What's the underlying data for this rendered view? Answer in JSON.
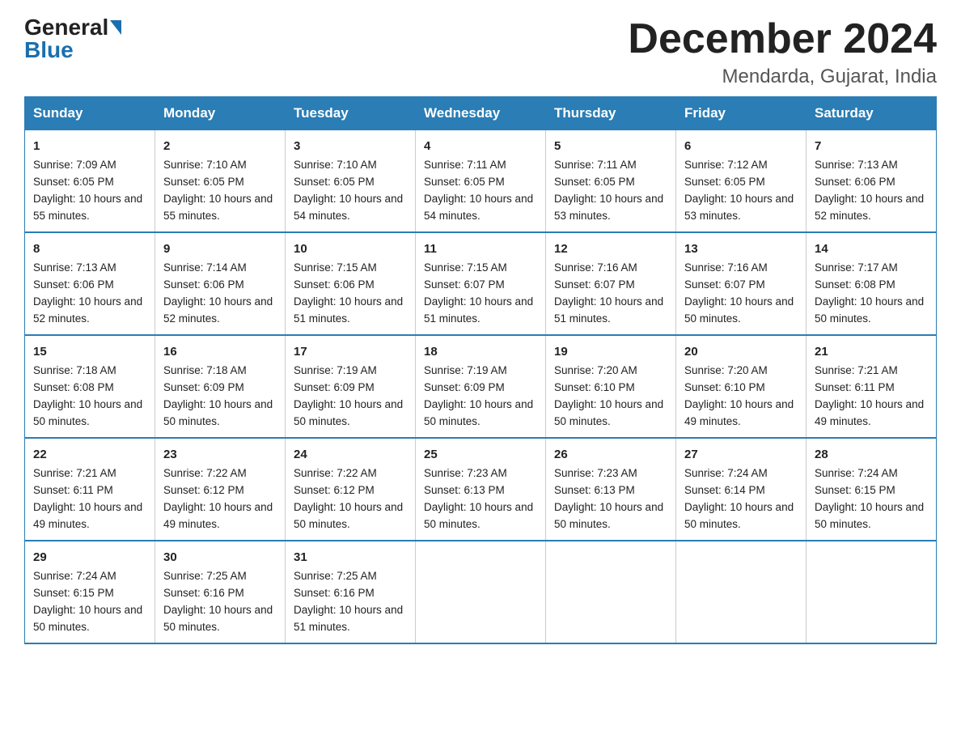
{
  "header": {
    "logo_general": "General",
    "logo_blue": "Blue",
    "month_year": "December 2024",
    "location": "Mendarda, Gujarat, India"
  },
  "days_of_week": [
    "Sunday",
    "Monday",
    "Tuesday",
    "Wednesday",
    "Thursday",
    "Friday",
    "Saturday"
  ],
  "weeks": [
    [
      {
        "day": 1,
        "sunrise": "7:09 AM",
        "sunset": "6:05 PM",
        "daylight": "10 hours and 55 minutes"
      },
      {
        "day": 2,
        "sunrise": "7:10 AM",
        "sunset": "6:05 PM",
        "daylight": "10 hours and 55 minutes"
      },
      {
        "day": 3,
        "sunrise": "7:10 AM",
        "sunset": "6:05 PM",
        "daylight": "10 hours and 54 minutes"
      },
      {
        "day": 4,
        "sunrise": "7:11 AM",
        "sunset": "6:05 PM",
        "daylight": "10 hours and 54 minutes"
      },
      {
        "day": 5,
        "sunrise": "7:11 AM",
        "sunset": "6:05 PM",
        "daylight": "10 hours and 53 minutes"
      },
      {
        "day": 6,
        "sunrise": "7:12 AM",
        "sunset": "6:05 PM",
        "daylight": "10 hours and 53 minutes"
      },
      {
        "day": 7,
        "sunrise": "7:13 AM",
        "sunset": "6:06 PM",
        "daylight": "10 hours and 52 minutes"
      }
    ],
    [
      {
        "day": 8,
        "sunrise": "7:13 AM",
        "sunset": "6:06 PM",
        "daylight": "10 hours and 52 minutes"
      },
      {
        "day": 9,
        "sunrise": "7:14 AM",
        "sunset": "6:06 PM",
        "daylight": "10 hours and 52 minutes"
      },
      {
        "day": 10,
        "sunrise": "7:15 AM",
        "sunset": "6:06 PM",
        "daylight": "10 hours and 51 minutes"
      },
      {
        "day": 11,
        "sunrise": "7:15 AM",
        "sunset": "6:07 PM",
        "daylight": "10 hours and 51 minutes"
      },
      {
        "day": 12,
        "sunrise": "7:16 AM",
        "sunset": "6:07 PM",
        "daylight": "10 hours and 51 minutes"
      },
      {
        "day": 13,
        "sunrise": "7:16 AM",
        "sunset": "6:07 PM",
        "daylight": "10 hours and 50 minutes"
      },
      {
        "day": 14,
        "sunrise": "7:17 AM",
        "sunset": "6:08 PM",
        "daylight": "10 hours and 50 minutes"
      }
    ],
    [
      {
        "day": 15,
        "sunrise": "7:18 AM",
        "sunset": "6:08 PM",
        "daylight": "10 hours and 50 minutes"
      },
      {
        "day": 16,
        "sunrise": "7:18 AM",
        "sunset": "6:09 PM",
        "daylight": "10 hours and 50 minutes"
      },
      {
        "day": 17,
        "sunrise": "7:19 AM",
        "sunset": "6:09 PM",
        "daylight": "10 hours and 50 minutes"
      },
      {
        "day": 18,
        "sunrise": "7:19 AM",
        "sunset": "6:09 PM",
        "daylight": "10 hours and 50 minutes"
      },
      {
        "day": 19,
        "sunrise": "7:20 AM",
        "sunset": "6:10 PM",
        "daylight": "10 hours and 50 minutes"
      },
      {
        "day": 20,
        "sunrise": "7:20 AM",
        "sunset": "6:10 PM",
        "daylight": "10 hours and 49 minutes"
      },
      {
        "day": 21,
        "sunrise": "7:21 AM",
        "sunset": "6:11 PM",
        "daylight": "10 hours and 49 minutes"
      }
    ],
    [
      {
        "day": 22,
        "sunrise": "7:21 AM",
        "sunset": "6:11 PM",
        "daylight": "10 hours and 49 minutes"
      },
      {
        "day": 23,
        "sunrise": "7:22 AM",
        "sunset": "6:12 PM",
        "daylight": "10 hours and 49 minutes"
      },
      {
        "day": 24,
        "sunrise": "7:22 AM",
        "sunset": "6:12 PM",
        "daylight": "10 hours and 50 minutes"
      },
      {
        "day": 25,
        "sunrise": "7:23 AM",
        "sunset": "6:13 PM",
        "daylight": "10 hours and 50 minutes"
      },
      {
        "day": 26,
        "sunrise": "7:23 AM",
        "sunset": "6:13 PM",
        "daylight": "10 hours and 50 minutes"
      },
      {
        "day": 27,
        "sunrise": "7:24 AM",
        "sunset": "6:14 PM",
        "daylight": "10 hours and 50 minutes"
      },
      {
        "day": 28,
        "sunrise": "7:24 AM",
        "sunset": "6:15 PM",
        "daylight": "10 hours and 50 minutes"
      }
    ],
    [
      {
        "day": 29,
        "sunrise": "7:24 AM",
        "sunset": "6:15 PM",
        "daylight": "10 hours and 50 minutes"
      },
      {
        "day": 30,
        "sunrise": "7:25 AM",
        "sunset": "6:16 PM",
        "daylight": "10 hours and 50 minutes"
      },
      {
        "day": 31,
        "sunrise": "7:25 AM",
        "sunset": "6:16 PM",
        "daylight": "10 hours and 51 minutes"
      },
      null,
      null,
      null,
      null
    ]
  ]
}
